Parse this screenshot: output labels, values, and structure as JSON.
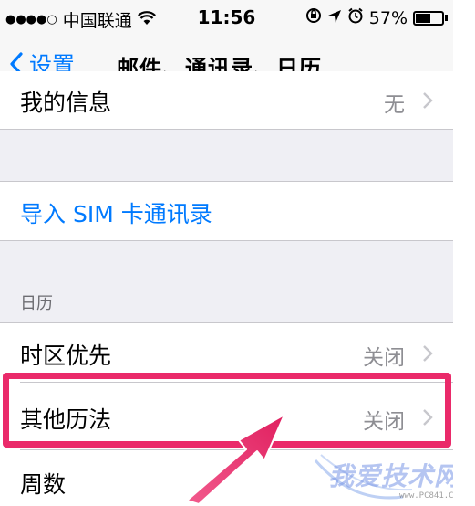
{
  "status_bar": {
    "signal": "●●●●○",
    "carrier": "中国联通",
    "time": "11:56",
    "battery_percent": "57%",
    "battery_level": 0.57
  },
  "nav": {
    "back_label": "设置",
    "title": "邮件、通讯录、日历"
  },
  "rows": {
    "my_info": {
      "label": "我的信息",
      "value": "无"
    },
    "import_sim": {
      "label": "导入 SIM 卡通讯录"
    },
    "calendar_header": "日历",
    "timezone": {
      "label": "时区优先",
      "value": "关闭"
    },
    "other_calendar": {
      "label": "其他历法",
      "value": "关闭"
    },
    "week_numbers": {
      "label": "周数"
    }
  },
  "watermark": {
    "text": "我爱技术网",
    "url": "www.PC841.COM"
  },
  "colors": {
    "accent": "#007aff",
    "highlight": "#ea2a6a",
    "secondary_text": "#8e8e93",
    "background": "#efeff4"
  }
}
